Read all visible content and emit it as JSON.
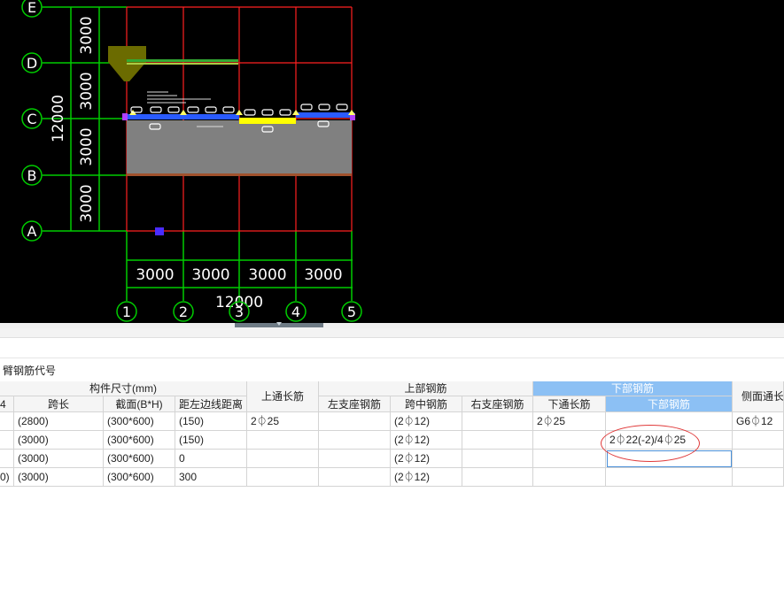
{
  "cad": {
    "axis_letters": [
      "E",
      "D",
      "C",
      "B",
      "A"
    ],
    "axis_numbers": [
      "1",
      "2",
      "3",
      "4",
      "5"
    ],
    "row_spans": [
      "3000",
      "3000",
      "3000",
      "3000"
    ],
    "col_spans": [
      "3000",
      "3000",
      "3000",
      "3000"
    ],
    "total_vertical": "12000",
    "total_horizontal": "12000",
    "colors": {
      "background": "#000000",
      "grid": "#ff0000",
      "dimension": "#00cc00",
      "slab": "#808080",
      "beam_blue": "#2a5bff",
      "beam_yellow": "#ffff00"
    }
  },
  "panel": {
    "title": "臂钢筋代号",
    "group_headers": {
      "size": "构件尺寸(mm)",
      "top_long": "上通长筋",
      "top_rebar": "上部钢筋",
      "bottom_rebar": "下部钢筋",
      "side_long": "侧面通长"
    },
    "columns": [
      "4",
      "跨长",
      "截面(B*H)",
      "距左边线距离",
      "左支座钢筋",
      "跨中钢筋",
      "右支座钢筋",
      "下通长筋",
      "下部钢筋"
    ],
    "rows": [
      {
        "c0": "",
        "span": "(2800)",
        "section": "(300*600)",
        "dist": "(150)",
        "top_long": "2⏀25",
        "left": "",
        "mid": "(2⏀12)",
        "right": "",
        "bot_long": "2⏀25",
        "bot": "",
        "side": "G6⏀12"
      },
      {
        "c0": "",
        "span": "(3000)",
        "section": "(300*600)",
        "dist": "(150)",
        "top_long": "",
        "left": "",
        "mid": "(2⏀12)",
        "right": "",
        "bot_long": "",
        "bot": "2⏀22(-2)/4⏀25",
        "side": ""
      },
      {
        "c0": "",
        "span": "(3000)",
        "section": "(300*600)",
        "dist": "0",
        "top_long": "",
        "left": "",
        "mid": "(2⏀12)",
        "right": "",
        "bot_long": "",
        "bot": "",
        "side": ""
      },
      {
        "c0": "0)",
        "span": "(3000)",
        "section": "(300*600)",
        "dist": "300",
        "top_long": "",
        "left": "",
        "mid": "(2⏀12)",
        "right": "",
        "bot_long": "",
        "bot": "",
        "side": ""
      }
    ]
  }
}
